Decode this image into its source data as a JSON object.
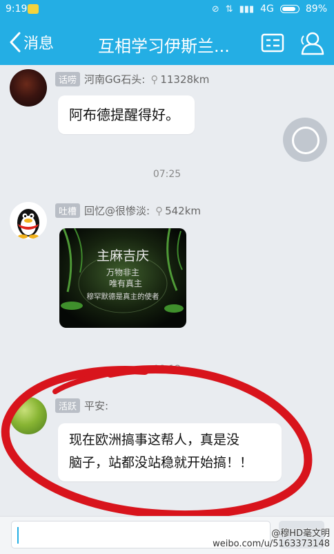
{
  "status_bar": {
    "time": "9:19",
    "network": "4G",
    "battery": "89%",
    "battery_level": 0.89
  },
  "header": {
    "back_label": "消息",
    "title": "互相学习伊斯兰..."
  },
  "messages": [
    {
      "tag": "话唠",
      "sender": "河南GG石头:",
      "distance": "11328km",
      "text": "阿布德提醒得好。"
    },
    {
      "timestamp": "07:25"
    },
    {
      "tag": "吐槽",
      "sender": "回忆@很惨淡:",
      "distance": "542km",
      "image_lines": [
        "主麻吉庆",
        "万物非主",
        "唯有真主",
        "穆罕默德是真主的使者"
      ]
    },
    {
      "timestamp": "08:12"
    },
    {
      "tag": "活跃",
      "sender": "平安:",
      "text_line1": "现在欧洲搞事这帮人，真是没",
      "text_line2": "脑子，站都没站稳就开始搞！！"
    }
  ],
  "input": {
    "placeholder": "",
    "value": ""
  },
  "watermark": {
    "line1": "@穆HD毫文明",
    "line2": "weibo.com/u/5163373148"
  },
  "colors": {
    "header_blue": "#24aee4",
    "annotation_red": "#d8141c"
  },
  "icons": [
    "back-chevron-icon",
    "profile-card-icon",
    "group-members-icon",
    "location-pin-icon",
    "floating-ring-icon"
  ]
}
